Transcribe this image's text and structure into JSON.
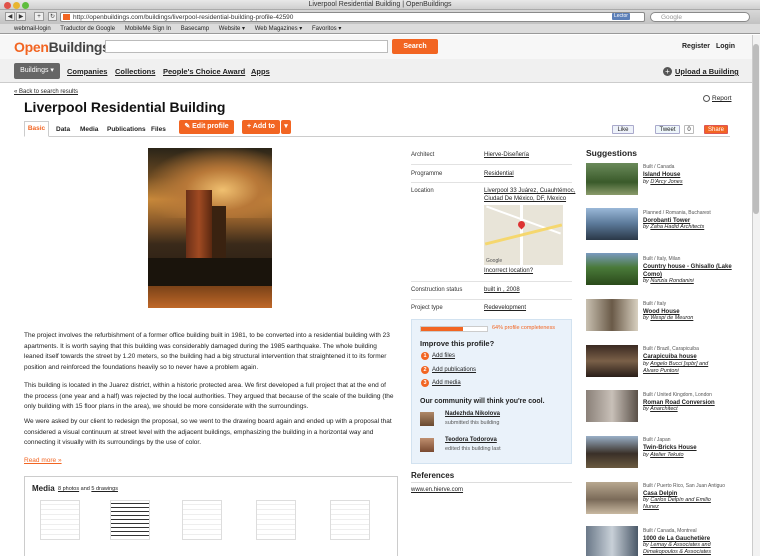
{
  "browser": {
    "window_title": "Liverpool Residential Building | OpenBuildings",
    "url": "http://openbuildings.com/buildings/liverpool-residential-building-profile-42590",
    "reader_badge": "Lector",
    "search_placeholder": "Google",
    "bookmarks": [
      "webmail-login",
      "Traductor de Google",
      "MobileMe Sign In",
      "Basecamp",
      "Website ▾",
      "Web Magazines ▾",
      "Favoritos ▾"
    ]
  },
  "header": {
    "logo_open": "Open",
    "logo_buildings": "Buildings",
    "search_button": "Search",
    "register": "Register",
    "login": "Login"
  },
  "nav": {
    "items": [
      "Buildings ▾",
      "Companies",
      "Collections",
      "People's Choice Award",
      "Apps"
    ],
    "upload": "Upload a Building"
  },
  "page": {
    "back_link": "« Back to search results",
    "report": "Report",
    "title": "Liverpool Residential Building",
    "tabs": [
      "Basic",
      "Data",
      "Media",
      "Publications",
      "Files"
    ],
    "edit_button": "✎ Edit profile",
    "add_button": "+ Add to",
    "add_caret": "▾",
    "like": "Like",
    "tweet": "Tweet",
    "tweet_count": "0",
    "share": "Share"
  },
  "description": {
    "p1": "The project involves the refurbishment of a former office building built in 1981, to be converted into a residential building with 23 apartments. It is worth saying that this building was considerably damaged during the 1985 earthquake. The whole building leaned itself towards the street by 1.20 meters, so the building had a big structural intervention that straightened it to its former position and reinforced the foundations heavily so to never have a problem again.",
    "p2": "This building is located in the Juarez district, within a historic protected area. We first developed a full project that at the end of the process (one year and a half) was rejected by the local authorities. They argued that because of the scale of the building (the only building with 15 floor plans in the area), we should be more considerate with the surroundings.",
    "p3": "We were asked by our client to redesign the proposal, so we went to the drawing board again and ended up with a proposal that considered a visual continuum at street level with the adjacent buildings, emphasizing the building in a horizontal way and connecting it visually with its surroundings by the use of color.",
    "read_more": "Read more »"
  },
  "media": {
    "title": "Media",
    "photos_link": "8 photos",
    "and": "and",
    "drawings_link": "5 drawings"
  },
  "details": {
    "architect_label": "Architect",
    "architect": "Hierve-Diseñería",
    "programme_label": "Programme",
    "programme": "Residential",
    "location_label": "Location",
    "location_l1": "Liverpool 33 Juárez, Cuauhtémoc,",
    "location_l2": "Ciudad De México, DF, Mexico",
    "map_brand": "Google",
    "incorrect_location": "Incorrect location?",
    "construction_label": "Construction status",
    "construction": "built in , 2008",
    "project_type_label": "Project type",
    "project_type": "Redevelopment"
  },
  "improve": {
    "completeness": 0.64,
    "completeness_text": "64% profile completeness",
    "title": "Improve this profile?",
    "steps": [
      {
        "num": "1",
        "label": "Add files"
      },
      {
        "num": "2",
        "label": "Add publications"
      },
      {
        "num": "3",
        "label": "Add media"
      }
    ],
    "community_title": "Our community will think you're cool.",
    "contributors": [
      {
        "name": "Nadezhda Nikolova",
        "action": "submitted this building"
      },
      {
        "name": "Teodora Todorova",
        "action": "edited this building last"
      }
    ]
  },
  "references": {
    "title": "References",
    "link": "www.en.hierve.com"
  },
  "suggestions": {
    "title": "Suggestions",
    "items": [
      {
        "meta": "Built / Canada",
        "name": "Island House",
        "by_prefix": "by",
        "by": "D'Arcy Jones",
        "by2": ""
      },
      {
        "meta": "Planned / Romania, Bucharest",
        "name": "Dorobanti Tower",
        "by_prefix": "by",
        "by": "Zaha Hadid Architects",
        "by2": ""
      },
      {
        "meta": "Built / Italy, Milan",
        "name": "Country house - Ghisallo (Lake Como)",
        "by_prefix": "by",
        "by": "Nunzia Rondanini",
        "by2": ""
      },
      {
        "meta": "Built / Italy",
        "name": "Wood House",
        "by_prefix": "by",
        "by": "Wespi de Meuron",
        "by2": ""
      },
      {
        "meta": "Built / Brazil, Carapicuiba",
        "name": "Carapicuiba house",
        "by_prefix": "by",
        "by": "Angelo Bucci [spbr] and",
        "by2": "Alvaro Puntoni"
      },
      {
        "meta": "Built / United Kingdom, London",
        "name": "Roman Road Conversion",
        "by_prefix": "by",
        "by": "Anarchitect",
        "by2": ""
      },
      {
        "meta": "Built / Japan",
        "name": "Twin-Bricks House",
        "by_prefix": "by",
        "by": "Atelier Tekuto",
        "by2": ""
      },
      {
        "meta": "Built / Puerto Rico, San Juan Antiguo",
        "name": "Casa Delpin",
        "by_prefix": "by",
        "by": "Carlos Delpín and Emilio",
        "by2": "Nunez"
      },
      {
        "meta": "Built / Canada, Montreal",
        "name": "1000 de La Gauchetière",
        "by_prefix": "by",
        "by": "Lemay & Associates and",
        "by2": "Dimakopoulos & Associates"
      }
    ]
  },
  "colors": {
    "accent": "#f26522",
    "nav_active": "#666666",
    "improve_bg": "#eaf2fa"
  }
}
